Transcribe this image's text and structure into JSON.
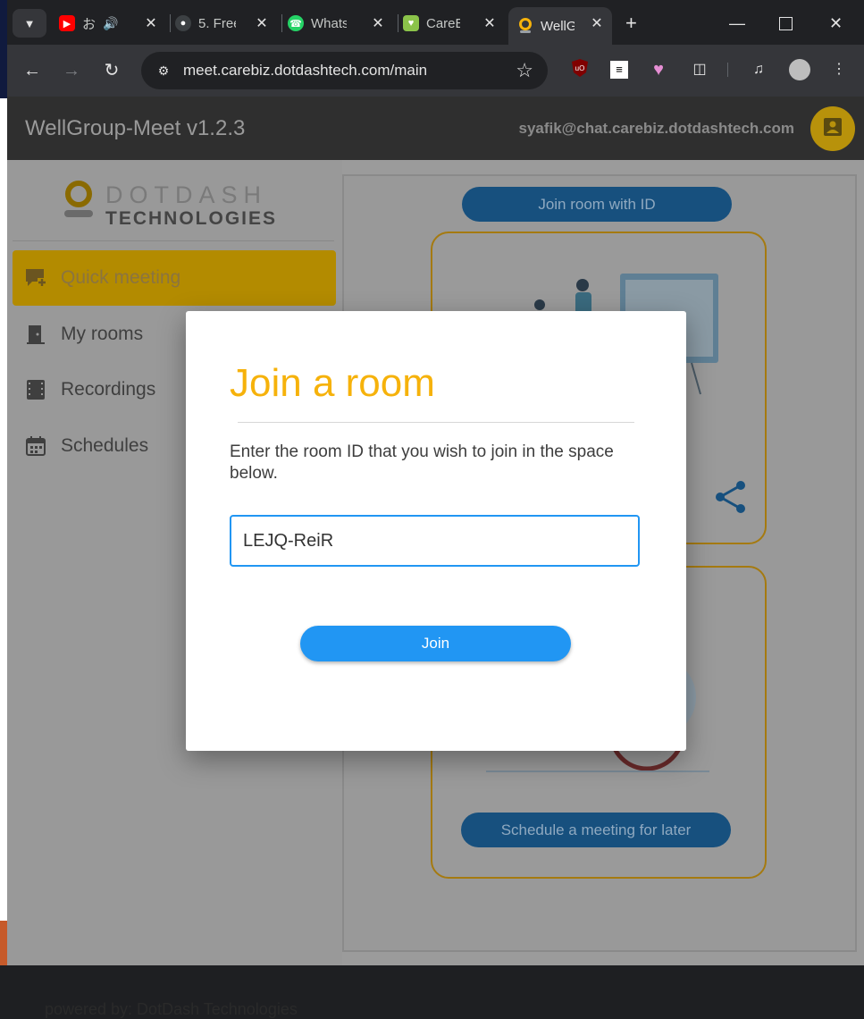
{
  "browser": {
    "tabs": [
      {
        "title": "お",
        "icon": "youtube-icon",
        "audio": true
      },
      {
        "title": "5. Free",
        "icon": "globe-icon"
      },
      {
        "title": "WhatsA",
        "icon": "whatsapp-icon"
      },
      {
        "title": "CareBi",
        "icon": "carebiz-icon"
      },
      {
        "title": "WellG",
        "icon": "wellgroup-icon",
        "active": true
      }
    ],
    "url": "meet.carebiz.dotdashtech.com/main"
  },
  "app": {
    "title": "WellGroup-Meet v1.2.3",
    "user_email": "syafik@chat.carebiz.dotdashtech.com",
    "logo": {
      "line1": "DOTDASH",
      "line2": "TECHNOLOGIES"
    },
    "nav": [
      {
        "label": "Quick meeting",
        "icon": "chat-plus-icon",
        "active": true
      },
      {
        "label": "My rooms",
        "icon": "door-icon"
      },
      {
        "label": "Recordings",
        "icon": "film-icon"
      },
      {
        "label": "Schedules",
        "icon": "calendar-icon"
      }
    ],
    "footer": "powered by: DotDash Technologies",
    "join_room_with_id": "Join room with ID",
    "schedule_later": "Schedule a meeting for later"
  },
  "modal": {
    "title": "Join a room",
    "description": "Enter the room ID that you wish to join in the space below.",
    "room_id_value": "LEJQ-ReiR",
    "join_label": "Join"
  },
  "colors": {
    "accent": "#f6b20b",
    "primary": "#2196f3",
    "appbar": "#2f2f2f"
  }
}
